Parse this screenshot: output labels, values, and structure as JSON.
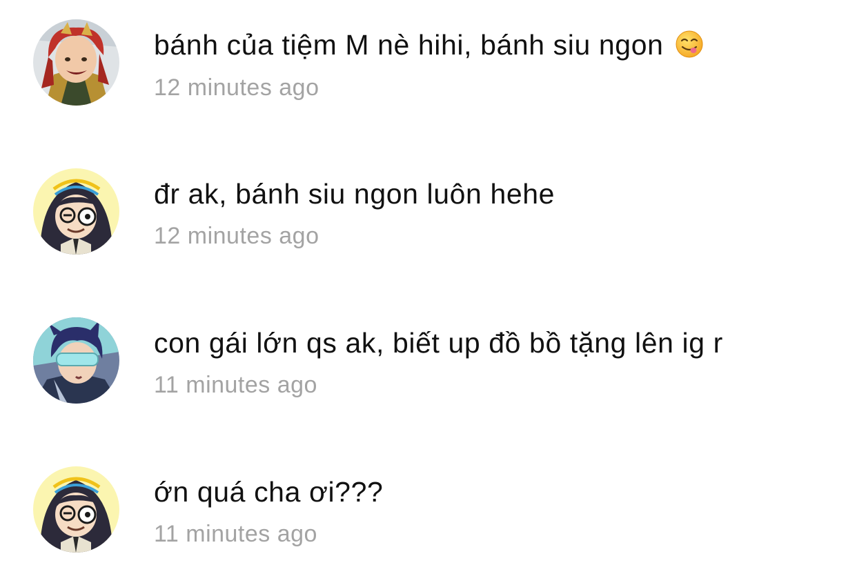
{
  "comments": [
    {
      "avatar": "avatar-red-haired-character",
      "text": "bánh của tiệm M nè hihi, bánh siu ngon",
      "emoji": "face-savoring-food-emoji",
      "time": "12 minutes ago"
    },
    {
      "avatar": "avatar-hooded-glasses-character",
      "text": "đr ak, bánh siu ngon luôn hehe",
      "time": "12 minutes ago"
    },
    {
      "avatar": "avatar-goggles-character",
      "text": "con gái lớn qs ak, biết up đồ bồ tặng lên ig r",
      "time": "11 minutes ago"
    },
    {
      "avatar": "avatar-hooded-glasses-character",
      "text": "ớn quá cha ơi???",
      "time": "11 minutes ago"
    }
  ],
  "colors": {
    "text": "#111111",
    "timestamp": "#a3a3a3",
    "background": "#ffffff"
  }
}
